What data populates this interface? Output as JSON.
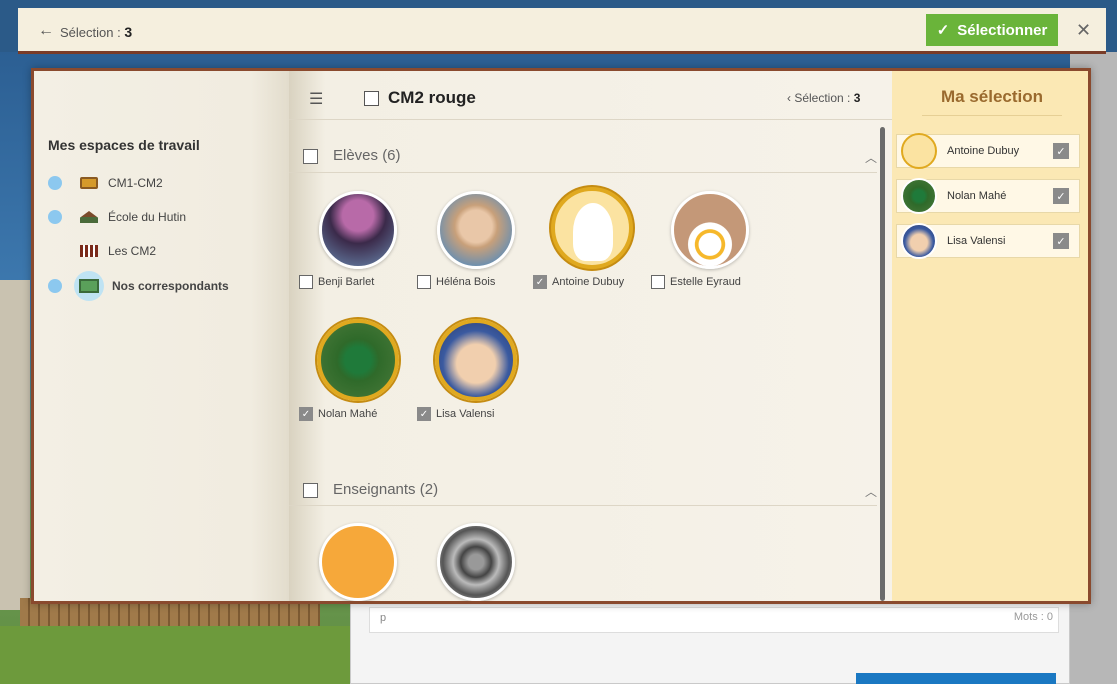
{
  "topbar": {
    "back_icon": "arrow-left-icon",
    "selection_label": "Sélection :",
    "selection_count": "3",
    "select_button": "Sélectionner",
    "close_icon": "close-icon"
  },
  "background": {
    "editor_placeholder": "p",
    "word_count": "Mots : 0"
  },
  "workspaces": {
    "title": "Mes espaces de travail",
    "items": [
      {
        "label": "CM1-CM2",
        "icon": "board-icon"
      },
      {
        "label": "École du Hutin",
        "icon": "school-icon"
      },
      {
        "label": "Les CM2",
        "icon": "class-icon"
      },
      {
        "label": "Nos correspondants",
        "icon": "correspondents-icon"
      }
    ]
  },
  "center": {
    "group_title": "CM2 rouge",
    "selection_label": "‹ Sélection :",
    "selection_count": "3",
    "sections": [
      {
        "title": "Elèves (6)",
        "members": [
          {
            "name": "Benji Barlet",
            "checked": false
          },
          {
            "name": "Héléna Bois",
            "checked": false
          },
          {
            "name": "Antoine Dubuy",
            "checked": true
          },
          {
            "name": "Estelle Eyraud",
            "checked": false
          },
          {
            "name": "Nolan Mahé",
            "checked": true
          },
          {
            "name": "Lisa Valensi",
            "checked": true
          }
        ]
      },
      {
        "title": "Enseignants (2)",
        "members": []
      }
    ]
  },
  "ma_selection": {
    "title": "Ma sélection",
    "items": [
      {
        "name": "Antoine Dubuy"
      },
      {
        "name": "Nolan Mahé"
      },
      {
        "name": "Lisa Valensi"
      }
    ]
  },
  "colors": {
    "accent_green": "#6ab43a",
    "selected_ring": "#e0a91f",
    "selection_panel": "#fbe8b4"
  }
}
